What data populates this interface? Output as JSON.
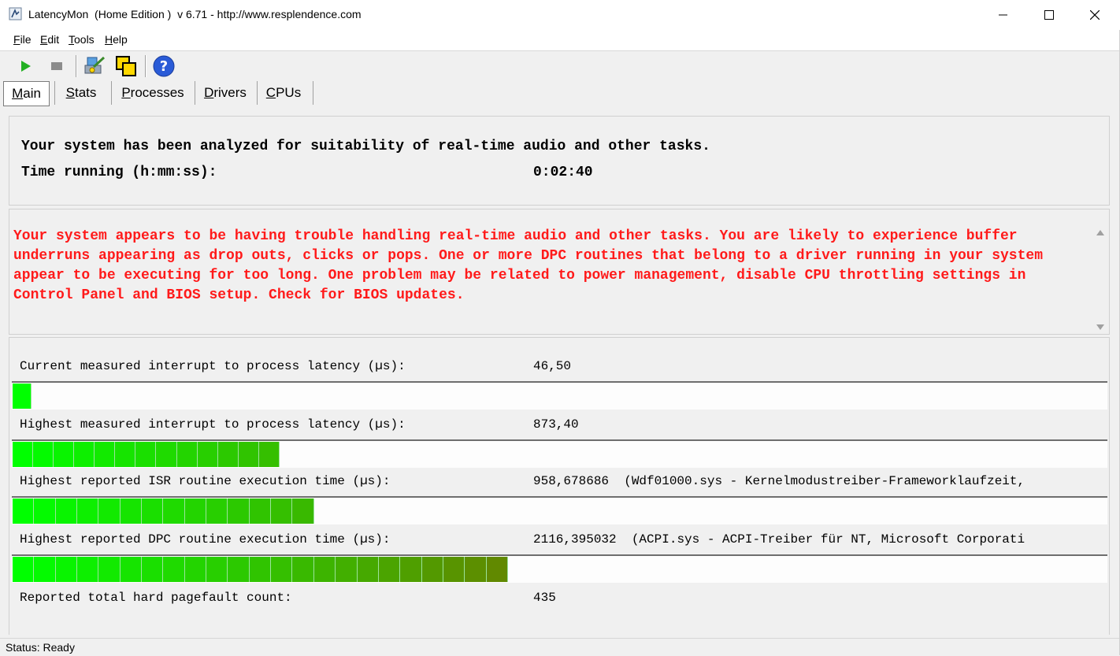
{
  "window": {
    "title": "LatencyMon  (Home Edition )  v 6.71 - http://www.resplendence.com",
    "icons": {
      "minimize": "minimize-icon",
      "maximize": "maximize-icon",
      "close": "close-icon"
    }
  },
  "menu": {
    "file": {
      "key": "F",
      "rest": "ile"
    },
    "edit": {
      "key": "E",
      "rest": "dit"
    },
    "tools": {
      "key": "T",
      "rest": "ools"
    },
    "help": {
      "key": "H",
      "rest": "elp"
    }
  },
  "toolbar": {
    "icons": [
      "play-icon",
      "stop-icon",
      "analyze-icon",
      "windows-icon",
      "help-icon"
    ],
    "colors": {
      "play": "#22b022",
      "stop": "#8c8c8c",
      "help": "#2a5bd7"
    }
  },
  "tabs": [
    {
      "key": "M",
      "rest": "ain"
    },
    {
      "key": "S",
      "rest": "tats"
    },
    {
      "key": "P",
      "rest": "rocesses"
    },
    {
      "key": "D",
      "rest": "rivers"
    },
    {
      "key": "C",
      "rest": "PUs"
    }
  ],
  "summary": {
    "line1": "Your system has been analyzed for suitability of real-time audio and other tasks.",
    "time_label": "Time running (h:mm:ss):",
    "time_value": "0:02:40"
  },
  "warning": {
    "text": "Your system appears to be having trouble handling real-time audio and other tasks. You are likely to experience buffer underruns appearing as drop outs, clicks or pops. One or more DPC routines that belong to a driver running in your system appear to be executing for too long. One problem may be related to power management, disable CPU throttling settings in Control Panel and BIOS setup. Check for BIOS updates.",
    "color": "#ff1a1a"
  },
  "metrics": [
    {
      "label": "Current measured interrupt to process latency (µs):",
      "value": "46,50",
      "detail": "",
      "fill_fraction": 0.017,
      "segments": 1
    },
    {
      "label": "Highest measured interrupt to process latency (µs):",
      "value": "873,40",
      "detail": "",
      "fill_fraction": 0.244,
      "segments": 13
    },
    {
      "label": "Highest reported ISR routine execution time (µs):",
      "value": "958,678686",
      "detail": "(Wdf01000.sys - Kernelmodustreiber-Frameworklaufzeit,",
      "fill_fraction": 0.276,
      "segments": 14
    },
    {
      "label": "Highest reported DPC routine execution time (µs):",
      "value": "2116,395032",
      "detail": "(ACPI.sys - ACPI-Treiber für NT, Microsoft Corporati",
      "fill_fraction": 0.453,
      "segments": 23
    },
    {
      "label": "Reported total hard pagefault count:",
      "value": "435",
      "detail": ""
    }
  ],
  "colors": {
    "bar_start": "#00ff00",
    "bar_end": "#a03c00"
  },
  "status": {
    "text": "Status: Ready"
  }
}
